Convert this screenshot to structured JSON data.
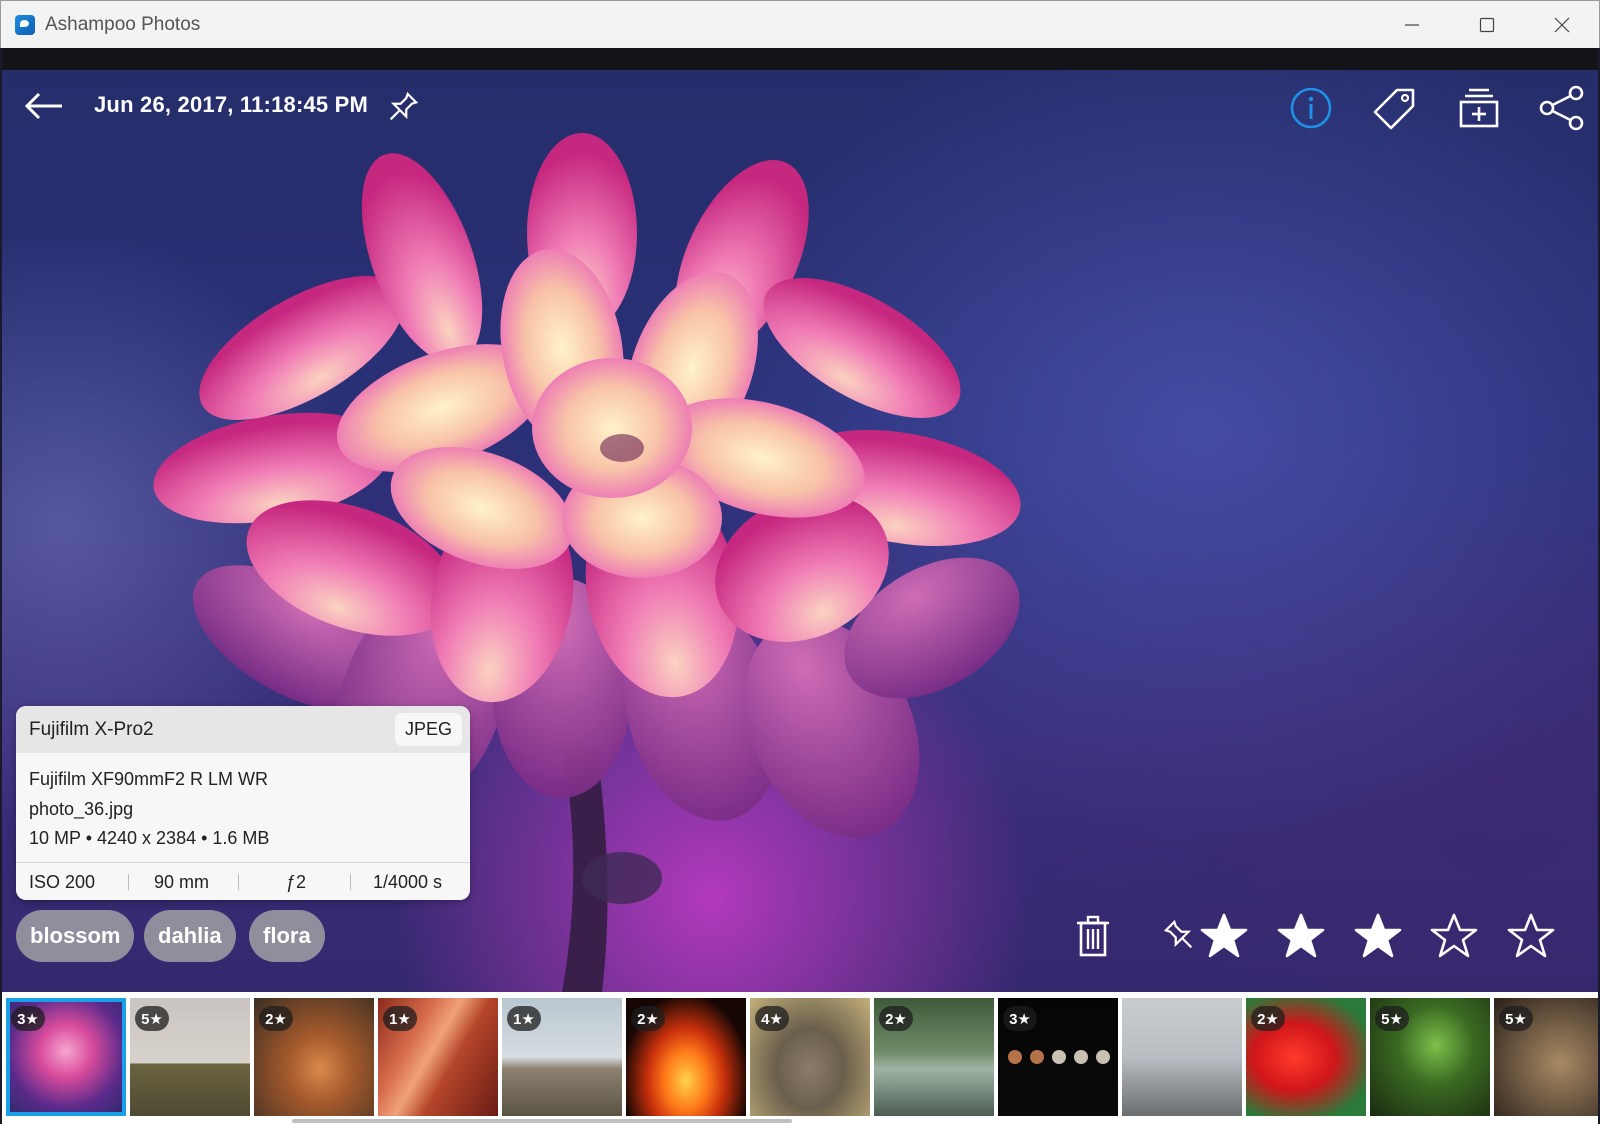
{
  "window": {
    "title": "Ashampoo Photos",
    "controls": [
      "minimize-icon",
      "maximize-icon",
      "close-icon"
    ]
  },
  "viewer": {
    "date_title": "Jun 26, 2017, 11:18:45 PM",
    "toolbar_icons": [
      "info-icon",
      "tag-icon",
      "add-to-album-icon",
      "share-icon"
    ],
    "accent_color": "#1e90e8"
  },
  "info": {
    "camera": "Fujifilm X-Pro2",
    "format": "JPEG",
    "lens": "Fujifilm XF90mmF2 R LM WR",
    "filename": "photo_36.jpg",
    "specs": "10 MP • 4240 x 2384 • 1.6 MB",
    "iso": "ISO 200",
    "focal": "90 mm",
    "aperture": "ƒ2",
    "shutter": "1/4000 s"
  },
  "tags": [
    "blossom",
    "dahlia",
    "flora"
  ],
  "rating": {
    "value": 3,
    "max": 5
  },
  "filmstrip": [
    {
      "rating": "3★",
      "selected": true
    },
    {
      "rating": "5★"
    },
    {
      "rating": "2★"
    },
    {
      "rating": "1★"
    },
    {
      "rating": "1★"
    },
    {
      "rating": "2★"
    },
    {
      "rating": "4★"
    },
    {
      "rating": "2★"
    },
    {
      "rating": "3★"
    },
    {
      "rating": ""
    },
    {
      "rating": "2★"
    },
    {
      "rating": "5★"
    },
    {
      "rating": "5★"
    }
  ]
}
